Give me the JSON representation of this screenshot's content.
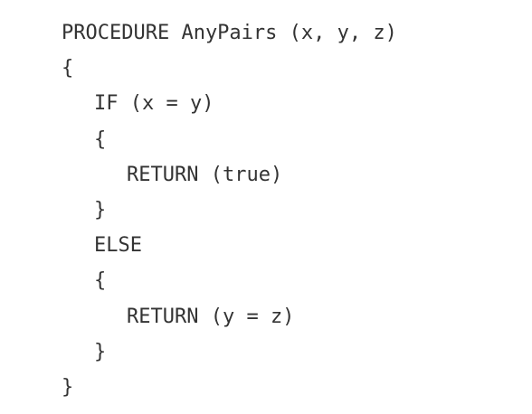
{
  "code": {
    "lines": [
      "PROCEDURE AnyPairs (x, y, z)",
      "{",
      "IF (x = y)",
      "{",
      "RETURN (true)",
      "}",
      "ELSE",
      "{",
      "RETURN (y = z)",
      "}",
      "}"
    ]
  }
}
